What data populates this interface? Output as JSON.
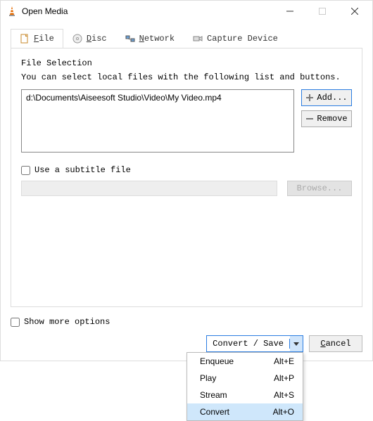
{
  "window": {
    "title": "Open Media"
  },
  "tabs": [
    {
      "label": "File"
    },
    {
      "label": "Disc"
    },
    {
      "label": "Network"
    },
    {
      "label": "Capture Device"
    }
  ],
  "file_section": {
    "title": "File Selection",
    "desc": "You can select local files with the following list and buttons.",
    "items": [
      "d:\\Documents\\Aiseesoft Studio\\Video\\My Video.mp4"
    ],
    "add_label": "Add...",
    "remove_label": "Remove"
  },
  "subtitle": {
    "check_label": "Use a subtitle file",
    "browse_label": "Browse..."
  },
  "show_more_label": "Show more options",
  "actions": {
    "convert_label": "Convert / Save",
    "cancel_label": "Cancel"
  },
  "menu": [
    {
      "label": "Enqueue",
      "shortcut": "Alt+E"
    },
    {
      "label": "Play",
      "shortcut": "Alt+P"
    },
    {
      "label": "Stream",
      "shortcut": "Alt+S"
    },
    {
      "label": "Convert",
      "shortcut": "Alt+O"
    }
  ]
}
